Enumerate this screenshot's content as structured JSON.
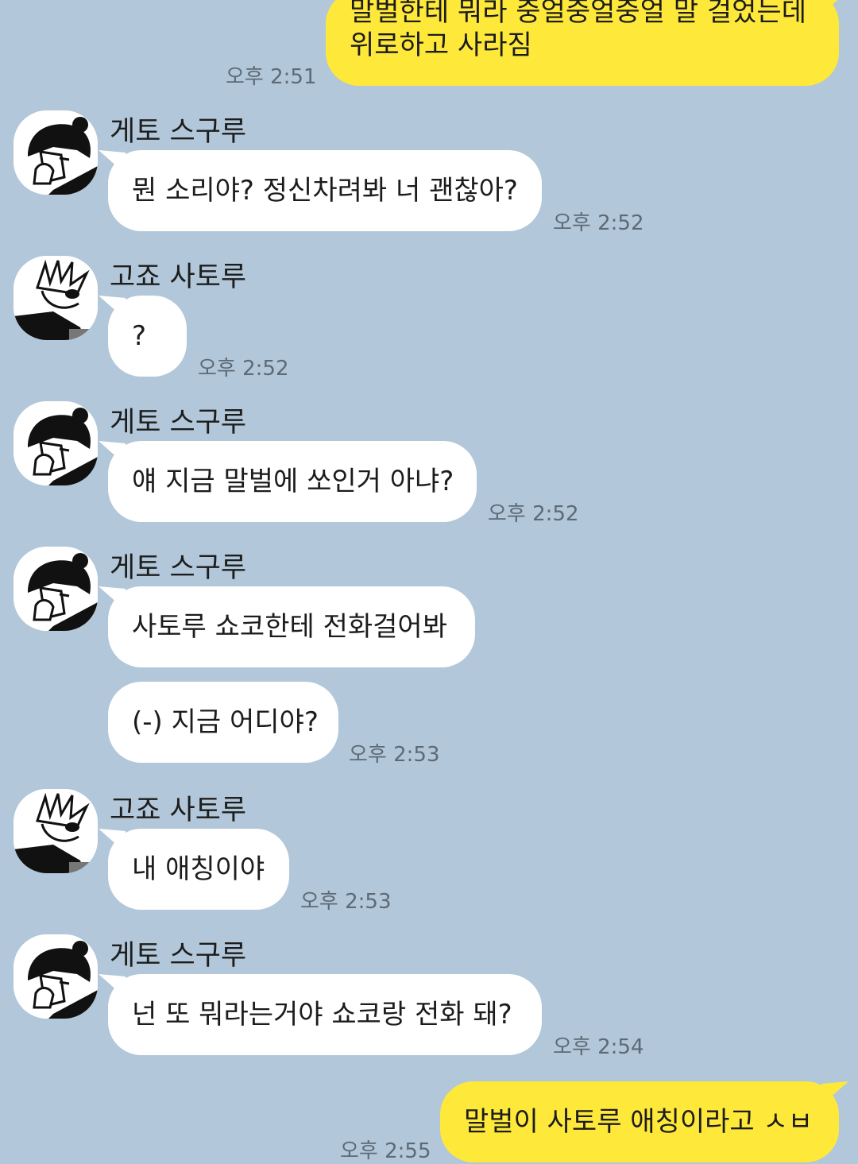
{
  "messages": [
    {
      "sender": "",
      "text": "말벌한테 뭐라 중얼중얼중얼 말 걸었는데\n위로하고 사라짐",
      "time": "오후 2:51",
      "mine": true
    },
    {
      "sender": "게토 스구루",
      "text": "뭔 소리야? 정신차려봐 너 괜찮아?",
      "time": "오후 2:52"
    },
    {
      "sender": "고죠 사토루",
      "text": "?",
      "time": "오후 2:52"
    },
    {
      "sender": "게토 스구루",
      "text": "얘 지금 말벌에 쏘인거 아냐?",
      "time": "오후 2:52"
    },
    {
      "sender": "게토 스구루",
      "text": "사토루 쇼코한테 전화걸어봐",
      "time": ""
    },
    {
      "sender": "",
      "text": "(-) 지금 어디야?",
      "time": "오후 2:53"
    },
    {
      "sender": "고죠 사토루",
      "text": "내 애칭이야",
      "time": "오후 2:53"
    },
    {
      "sender": "게토 스구루",
      "text": "넌 또 뭐라는거야 쇼코랑 전화 돼?",
      "time": "오후 2:54"
    },
    {
      "sender": "",
      "text": "말벌이 사토루 애칭이라고 ㅅㅂ",
      "time": "오후 2:55",
      "mine": true
    }
  ],
  "icons": {
    "geto_avatar": "geto-avatar-icon",
    "gojo_avatar": "gojo-avatar-icon"
  },
  "colors": {
    "background": "#b2c7d9",
    "my_bubble": "#fee93a",
    "other_bubble": "#ffffff",
    "time_text": "#5d6a76"
  }
}
